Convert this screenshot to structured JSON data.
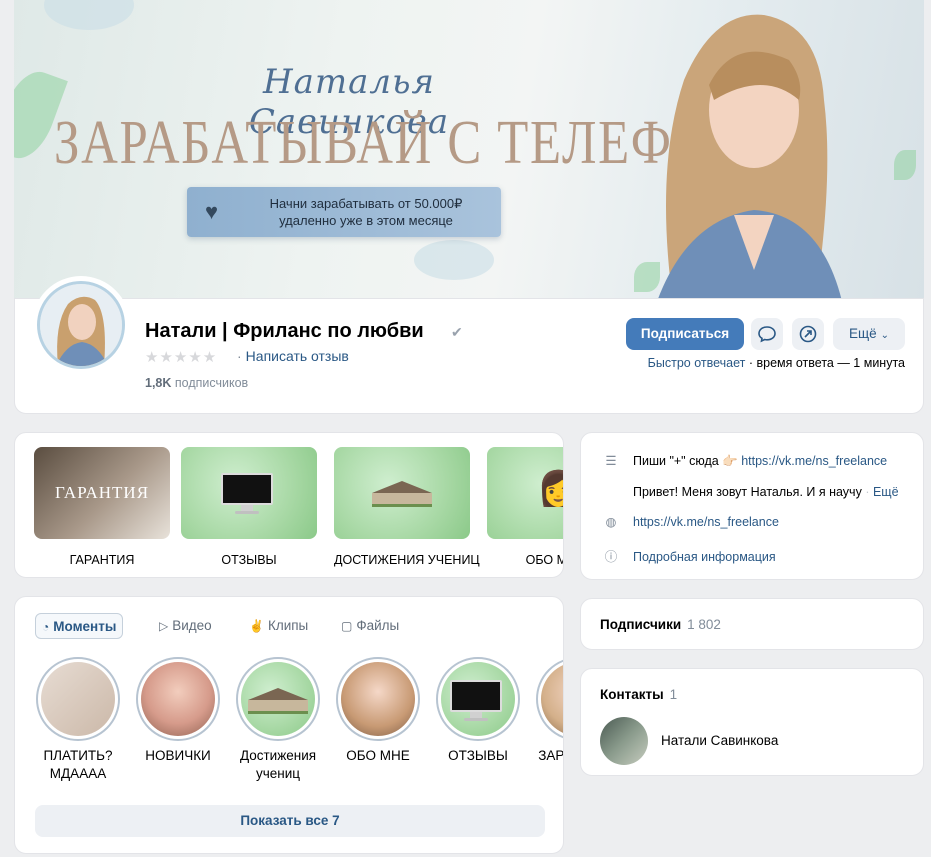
{
  "cover": {
    "signature": "Наталья Савинкова",
    "headline": "ЗАРАБАТЫВАЙ С ТЕЛЕФОНА",
    "promo_line1": "Начни зарабатывать от 50.000₽",
    "promo_line2": "удаленно уже в этом месяце"
  },
  "profile": {
    "name": "Натали | Фриланс по любви",
    "stars": "★★★★★",
    "review_link": "Написать отзыв",
    "subscribers_count": "1,8K",
    "subscribers_label": "подписчиков",
    "subscribe_button": "Подписаться",
    "more_button": "Ещё",
    "fast_reply": "Быстро отвечает",
    "reply_time": " · время ответа — 1 минута"
  },
  "highlights": [
    {
      "label": "ГАРАНТИЯ",
      "thumb_text": "ГАРАНТИЯ"
    },
    {
      "label": "ОТЗЫВЫ"
    },
    {
      "label": "ДОСТИЖЕНИЯ УЧЕНИЦ"
    },
    {
      "label": "ОБО МНЕ"
    }
  ],
  "info": {
    "status_text": "Пиши \"+\" сюда 👉🏻 ",
    "status_link": "https://vk.me/ns_freelance",
    "about_text": "Привет! Меня зовут Наталья. И я научу",
    "about_more": "Ещё",
    "site_link": "https://vk.me/ns_freelance",
    "details_link": "Подробная информация"
  },
  "media": {
    "tabs": [
      "Моменты",
      "Видео",
      "Клипы",
      "Файлы"
    ],
    "stories": [
      {
        "label": "ПЛАТИТЬ? МДАААА"
      },
      {
        "label": "НОВИЧКИ"
      },
      {
        "label": "Достижения учениц"
      },
      {
        "label": "ОБО МНЕ"
      },
      {
        "label": "ОТЗЫВЫ"
      },
      {
        "label": "ЗАРАБОТОК"
      }
    ],
    "show_all": "Показать все 7"
  },
  "subscribers": {
    "title": "Подписчики",
    "count": "1 802"
  },
  "contacts": {
    "title": "Контакты",
    "count": "1",
    "name": "Натали Савинкова"
  },
  "colors": {
    "accent": "#447bba",
    "link": "#2a5885",
    "background": "#edeef0"
  }
}
